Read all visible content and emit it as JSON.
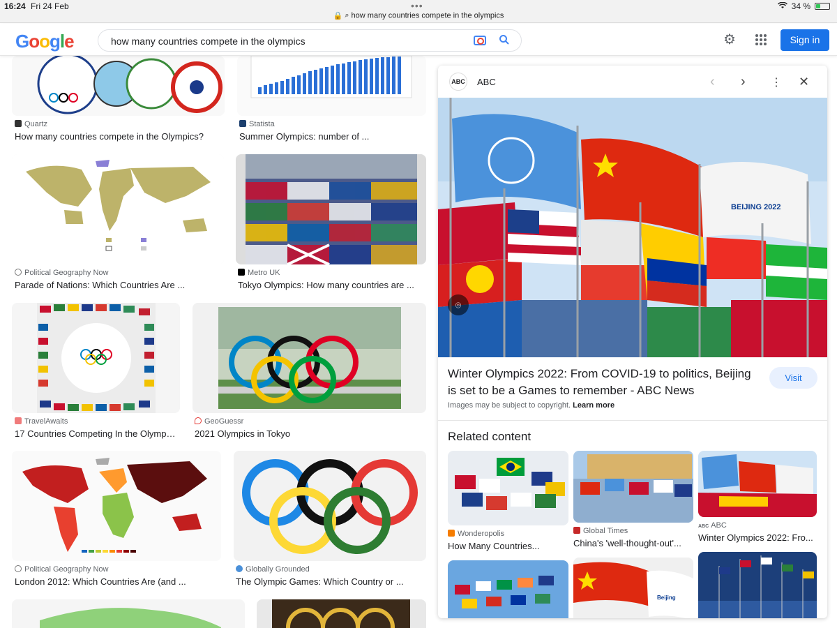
{
  "status": {
    "time": "16:24",
    "date": "Fri 24 Feb",
    "battery": "34 %",
    "battery_level": 0.34
  },
  "url": "how many countries compete in the olympics",
  "header": {
    "logo": [
      "G",
      "o",
      "o",
      "g",
      "l",
      "e"
    ],
    "query": "how many countries compete in the olympics",
    "signin": "Sign in"
  },
  "results": [
    {
      "source": "Quartz",
      "title": "How many countries compete in the Olympics?"
    },
    {
      "source": "Statista",
      "title": "Summer Olympics: number of ..."
    },
    {
      "source": "Political Geography Now",
      "title": "Parade of Nations: Which Countries Are ..."
    },
    {
      "source": "Metro UK",
      "title": "Tokyo Olympics: How many countries are ..."
    },
    {
      "source": "TravelAwaits",
      "title": "17 Countries Competing In the Olympic..."
    },
    {
      "source": "GeoGuessr",
      "title": "2021 Olympics in Tokyo"
    },
    {
      "source": "Political Geography Now",
      "title": "London 2012: Which Countries Are (and ..."
    },
    {
      "source": "Globally Grounded",
      "title": "The Olympic Games: Which Country or ..."
    }
  ],
  "panel": {
    "source": "ABC",
    "title": "Winter Olympics 2022: From COVID-19 to politics, Beijing is set to be a Games to remember - ABC News",
    "visit": "Visit",
    "copyright": "Images may be subject to copyright.",
    "learn_more": "Learn more",
    "related_heading": "Related content",
    "related": [
      {
        "source": "Wonderopolis",
        "title": "How Many Countries..."
      },
      {
        "source": "Global Times",
        "title": "China's 'well-thought-out'..."
      },
      {
        "source": "ABC",
        "title": "Winter Olympics 2022: Fro..."
      }
    ]
  }
}
